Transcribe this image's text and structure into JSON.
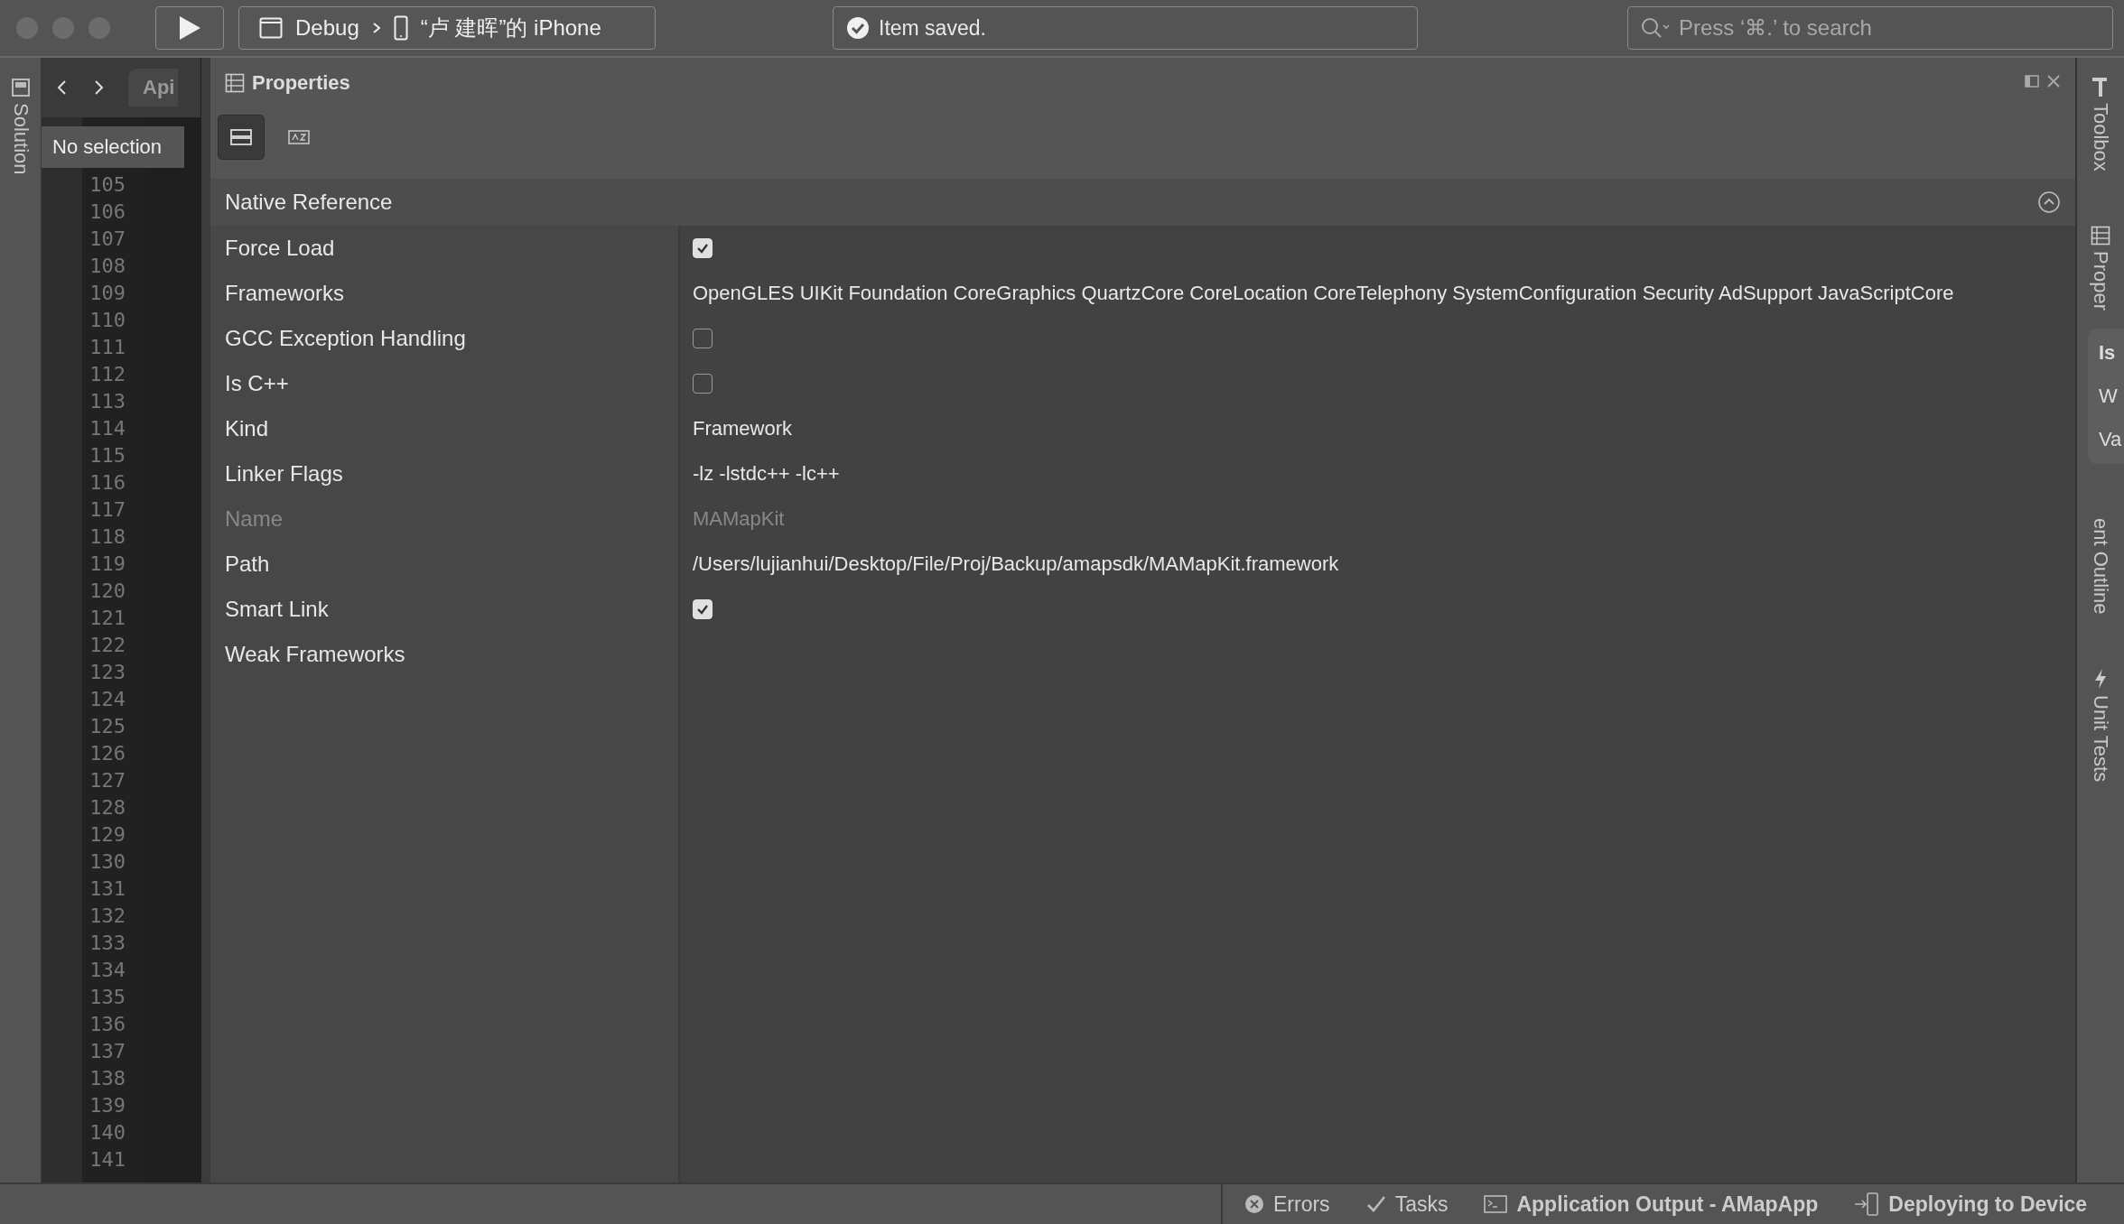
{
  "toolbar": {
    "configuration": "Debug",
    "device": "“卢 建晖”的 iPhone",
    "status": "Item saved.",
    "search": {
      "placeholder": "Press ‘⌘.’ to search"
    }
  },
  "left_dock": {
    "items": [
      "Solution"
    ]
  },
  "editor": {
    "tab": "Api",
    "tooltip": "No selection",
    "line_numbers": [
      "105",
      "106",
      "107",
      "108",
      "109",
      "110",
      "111",
      "112",
      "113",
      "114",
      "115",
      "116",
      "117",
      "118",
      "119",
      "120",
      "121",
      "122",
      "123",
      "124",
      "125",
      "126",
      "127",
      "128",
      "129",
      "130",
      "131",
      "132",
      "133",
      "134",
      "135",
      "136",
      "137",
      "138",
      "139",
      "140",
      "141"
    ]
  },
  "properties": {
    "title": "Properties",
    "view_buttons": [
      {
        "kind": "categorized",
        "selected": true
      },
      {
        "kind": "alphabetical",
        "selected": false
      }
    ],
    "section": {
      "title": "Native Reference",
      "expanded": true
    },
    "rows": [
      {
        "label": "Force Load",
        "kind": "checkbox",
        "checked": true,
        "disabled": false
      },
      {
        "label": "Frameworks",
        "kind": "text",
        "value": "OpenGLES UIKit Foundation CoreGraphics QuartzCore CoreLocation CoreTelephony SystemConfiguration Security AdSupport JavaScriptCore",
        "disabled": false
      },
      {
        "label": "GCC Exception Handling",
        "kind": "checkbox",
        "checked": false,
        "disabled": false
      },
      {
        "label": "Is C++",
        "kind": "checkbox",
        "checked": false,
        "disabled": false
      },
      {
        "label": "Kind",
        "kind": "text",
        "value": "Framework",
        "disabled": false
      },
      {
        "label": "Linker Flags",
        "kind": "text",
        "value": "-lz -lstdc++ -lc++",
        "disabled": false
      },
      {
        "label": "Name",
        "kind": "text",
        "value": "MAMapKit",
        "disabled": true
      },
      {
        "label": "Path",
        "kind": "text",
        "value": "/Users/lujianhui/Desktop/File/Proj/Backup/amapsdk/MAMapKit.framework",
        "disabled": false
      },
      {
        "label": "Smart Link",
        "kind": "checkbox",
        "checked": true,
        "disabled": false
      },
      {
        "label": "Weak Frameworks",
        "kind": "text",
        "disabled": false
      }
    ]
  },
  "right_dock": {
    "items": [
      {
        "label": "Toolbox",
        "kind": "hammer"
      },
      {
        "label": "Proper",
        "kind": "list"
      },
      {
        "label": "ent Outline",
        "kind": "none"
      },
      {
        "label": "Unit Tests",
        "kind": "bolt"
      }
    ],
    "popover": [
      {
        "label": "Is",
        "selected": true
      },
      {
        "label": "W",
        "selected": false
      },
      {
        "label": "Va",
        "selected": false
      }
    ]
  },
  "status_bar": [
    {
      "label": "Errors",
      "kind": "errors",
      "bold": false
    },
    {
      "label": "Tasks",
      "kind": "tasks",
      "bold": false
    },
    {
      "label": "Application Output - AMapApp",
      "kind": "output",
      "bold": true
    },
    {
      "label": "Deploying to Device",
      "kind": "device",
      "bold": true
    }
  ]
}
